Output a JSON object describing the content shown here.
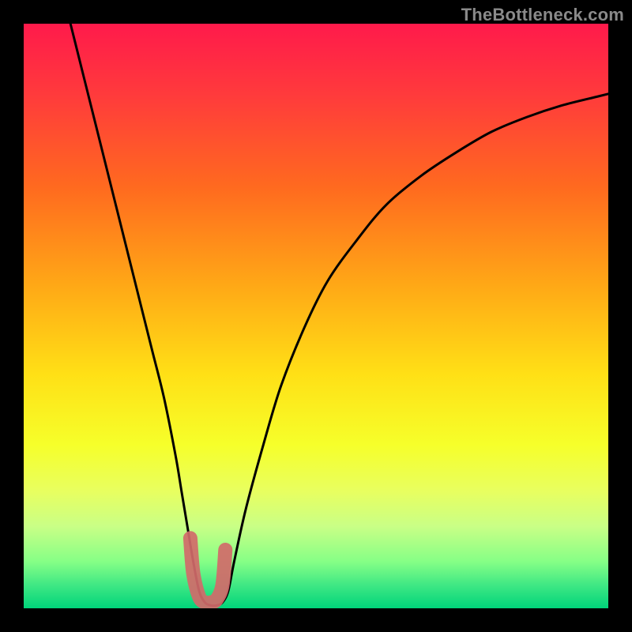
{
  "watermark": "TheBottleneck.com",
  "chart_data": {
    "type": "line",
    "title": "",
    "xlabel": "",
    "ylabel": "",
    "xlim": [
      0,
      100
    ],
    "ylim": [
      0,
      100
    ],
    "grid": false,
    "legend": false,
    "background_gradient": {
      "stops": [
        {
          "offset": 0.0,
          "color": "#ff1a4b"
        },
        {
          "offset": 0.12,
          "color": "#ff3a3c"
        },
        {
          "offset": 0.28,
          "color": "#ff6a1f"
        },
        {
          "offset": 0.45,
          "color": "#ffa916"
        },
        {
          "offset": 0.6,
          "color": "#ffe016"
        },
        {
          "offset": 0.72,
          "color": "#f6ff2a"
        },
        {
          "offset": 0.8,
          "color": "#e8ff60"
        },
        {
          "offset": 0.86,
          "color": "#c9ff86"
        },
        {
          "offset": 0.92,
          "color": "#86ff86"
        },
        {
          "offset": 0.96,
          "color": "#40e884"
        },
        {
          "offset": 1.0,
          "color": "#00d47a"
        }
      ]
    },
    "series": [
      {
        "name": "bottleneck-curve",
        "stroke": "#000000",
        "stroke_width": 3,
        "x": [
          8,
          10,
          12,
          14,
          16,
          18,
          20,
          22,
          24,
          26,
          27,
          28,
          29,
          30,
          31,
          32,
          33,
          34,
          35,
          36,
          38,
          41,
          44,
          48,
          52,
          57,
          62,
          68,
          74,
          80,
          86,
          92,
          98,
          100
        ],
        "y": [
          100,
          92,
          84,
          76,
          68,
          60,
          52,
          44,
          36,
          26,
          20,
          14,
          8,
          3,
          1,
          0.5,
          0.5,
          1,
          3,
          8,
          17,
          28,
          38,
          48,
          56,
          63,
          69,
          74,
          78,
          81.5,
          84,
          86,
          87.5,
          88
        ]
      },
      {
        "name": "highlight-range",
        "stroke": "#d16a6a",
        "stroke_width": 18,
        "stroke_linecap": "round",
        "x": [
          28.5,
          29,
          30,
          31,
          32,
          33,
          34,
          34.5
        ],
        "y": [
          12,
          6,
          2,
          1,
          1,
          1.5,
          4,
          10
        ]
      }
    ]
  }
}
